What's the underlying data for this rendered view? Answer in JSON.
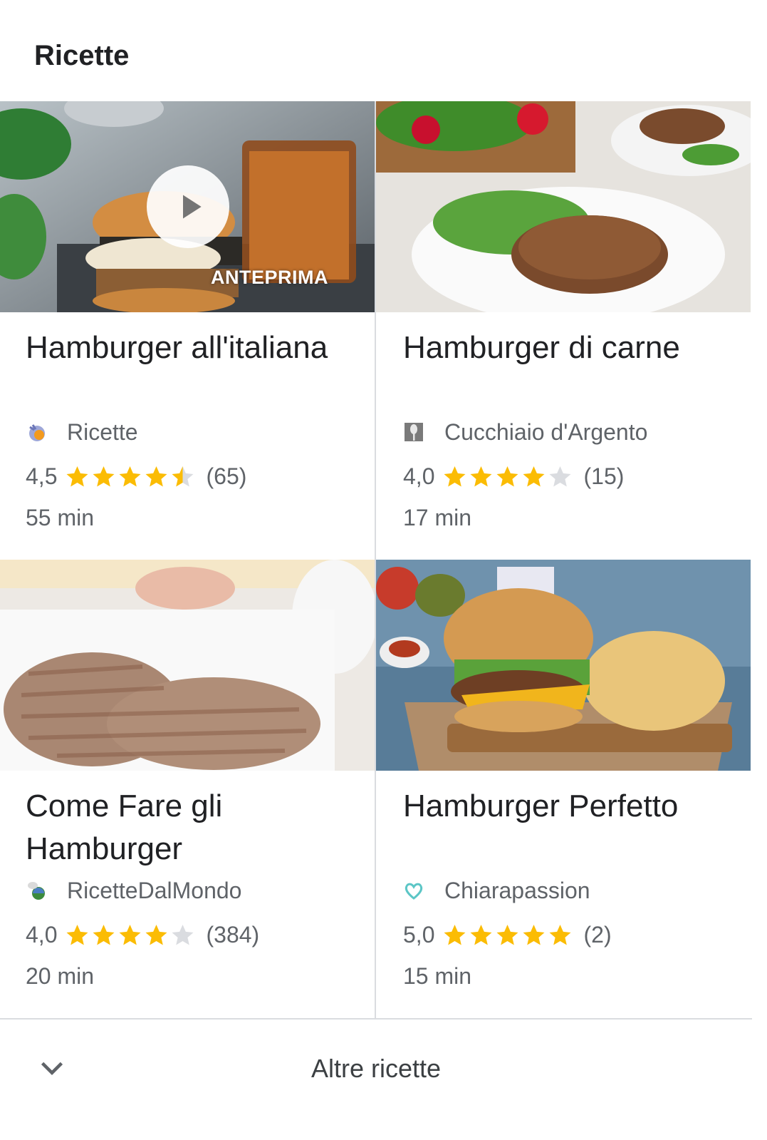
{
  "section_title": "Ricette",
  "recipes": [
    {
      "title": "Hamburger all'italiana",
      "source": "Ricette",
      "favicon": "chef-mascot-icon",
      "rating": "4,5",
      "stars": 4.5,
      "reviews": "(65)",
      "time": "55 min",
      "preview_label": "ANTEPRIMA"
    },
    {
      "title": "Hamburger di carne",
      "source": "Cucchiaio d'Argento",
      "favicon": "spoon-icon",
      "rating": "4,0",
      "stars": 4,
      "reviews": "(15)",
      "time": "17 min"
    },
    {
      "title": "Come Fare gli Hamburger",
      "source": "RicetteDalMondo",
      "favicon": "globe-chef-icon",
      "rating": "4,0",
      "stars": 4,
      "reviews": "(384)",
      "time": "20 min"
    },
    {
      "title": "Hamburger Perfetto",
      "source": "Chiarapassion",
      "favicon": "heart-icon",
      "rating": "5,0",
      "stars": 5,
      "reviews": "(2)",
      "time": "15 min"
    }
  ],
  "footer": {
    "label": "Altre ricette",
    "icon": "chevron-down-icon"
  },
  "colors": {
    "star_filled": "#fbbc04",
    "star_empty": "#dadce0",
    "text_secondary": "#5f6368",
    "divider": "#dadce0"
  }
}
